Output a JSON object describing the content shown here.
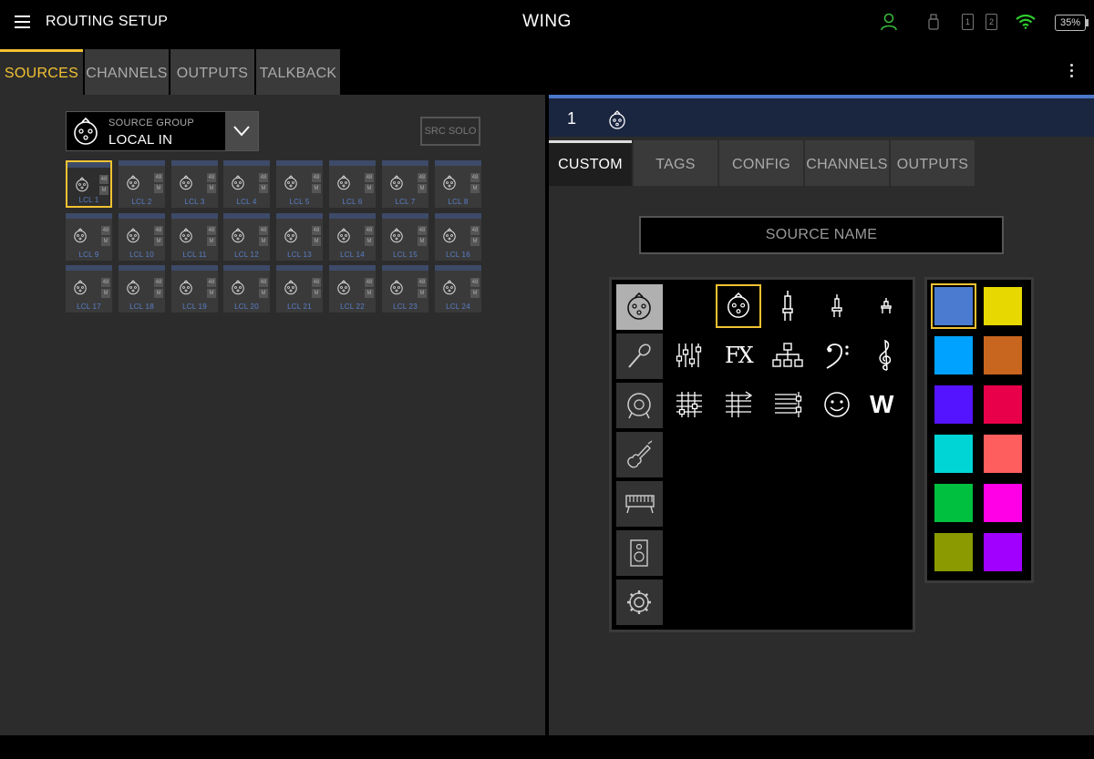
{
  "header": {
    "title": "ROUTING SETUP",
    "brand": "WING",
    "slot1": "1",
    "slot2": "2",
    "battery": "35%"
  },
  "main_tabs": [
    "SOURCES",
    "CHANNELS",
    "OUTPUTS",
    "TALKBACK"
  ],
  "left": {
    "source_group_caption": "SOURCE GROUP",
    "source_group_value": "LOCAL IN",
    "src_solo": "SRC SOLO",
    "badge_48": "48",
    "badge_m": "M",
    "sources": [
      "LCL 1",
      "LCL 2",
      "LCL 3",
      "LCL 4",
      "LCL 5",
      "LCL 6",
      "LCL 7",
      "LCL 8",
      "LCL 9",
      "LCL 10",
      "LCL 11",
      "LCL 12",
      "LCL 13",
      "LCL 14",
      "LCL 15",
      "LCL 16",
      "LCL 17",
      "LCL 18",
      "LCL 19",
      "LCL 20",
      "LCL 21",
      "LCL 22",
      "LCL 23",
      "LCL 24"
    ]
  },
  "right": {
    "number": "1",
    "sub_tabs": [
      "CUSTOM",
      "TAGS",
      "CONFIG",
      "CHANNELS",
      "OUTPUTS"
    ],
    "name_placeholder": "SOURCE NAME",
    "icon_glyphs": {
      "fx": "FX",
      "w": "W"
    }
  },
  "colors": [
    "#4a7bd1",
    "#e6d800",
    "#00a2ff",
    "#c8651e",
    "#5514ff",
    "#e8004a",
    "#00d5d5",
    "#ff5e5e",
    "#00c040",
    "#ff00e6",
    "#8a9a00",
    "#a100ff"
  ]
}
